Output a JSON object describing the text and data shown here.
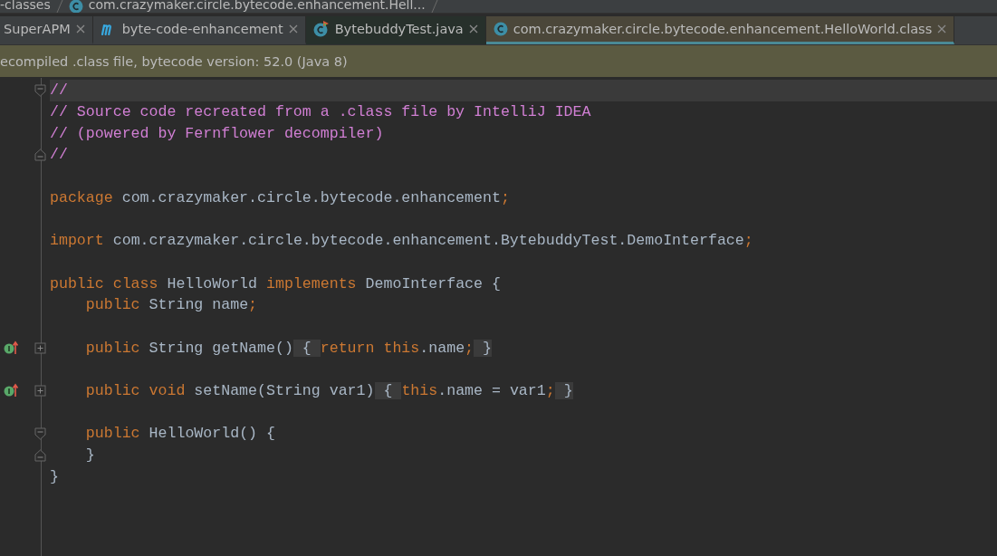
{
  "breadcrumb": [
    {
      "label": "-classes",
      "kind": "folder"
    },
    {
      "label": "com.crazymaker.circle.bytecode.enhancement.Hell...",
      "kind": "class"
    }
  ],
  "tabs": [
    {
      "label": "SuperAPM",
      "kind": "plain",
      "selected": false,
      "pinned": false
    },
    {
      "label": "byte-code-enhancement",
      "kind": "module",
      "selected": false,
      "pinned": false
    },
    {
      "label": "BytebuddyTest.java",
      "kind": "source",
      "selected": false,
      "pinned": true
    },
    {
      "label": "com.crazymaker.circle.bytecode.enhancement.HelloWorld.class",
      "kind": "class",
      "selected": true,
      "pinned": false
    }
  ],
  "banner": "ecompiled .class file, bytecode version: 52.0 (Java 8)",
  "code_lines": [
    {
      "kind": "fold-start",
      "current": true,
      "tokens": [
        {
          "kind": "comment",
          "text": "//"
        }
      ]
    },
    {
      "kind": "code",
      "tokens": [
        {
          "kind": "comment",
          "text": "// Source code recreated from a .class file by IntelliJ IDEA"
        }
      ]
    },
    {
      "kind": "code",
      "tokens": [
        {
          "kind": "comment",
          "text": "// (powered by Fernflower decompiler)"
        }
      ]
    },
    {
      "kind": "fold-end",
      "tokens": [
        {
          "kind": "comment",
          "text": "//"
        }
      ]
    },
    {
      "kind": "blank"
    },
    {
      "kind": "code",
      "tokens": [
        {
          "kind": "keyword",
          "text": "package "
        },
        {
          "kind": "plain",
          "text": "com.crazymaker.circle.bytecode.enhancement"
        },
        {
          "kind": "keyword",
          "text": ";"
        }
      ]
    },
    {
      "kind": "blank"
    },
    {
      "kind": "code",
      "tokens": [
        {
          "kind": "keyword",
          "text": "import "
        },
        {
          "kind": "plain",
          "text": "com.crazymaker.circle.bytecode.enhancement.BytebuddyTest.DemoInterface"
        },
        {
          "kind": "keyword",
          "text": ";"
        }
      ]
    },
    {
      "kind": "blank"
    },
    {
      "kind": "code",
      "tokens": [
        {
          "kind": "keyword",
          "text": "public class "
        },
        {
          "kind": "plain",
          "text": "HelloWorld "
        },
        {
          "kind": "keyword",
          "text": "implements "
        },
        {
          "kind": "plain",
          "text": "DemoInterface {"
        }
      ]
    },
    {
      "kind": "code",
      "tokens": [
        {
          "kind": "keyword",
          "text": "    public "
        },
        {
          "kind": "plain",
          "text": "String name"
        },
        {
          "kind": "keyword",
          "text": ";"
        }
      ]
    },
    {
      "kind": "blank"
    },
    {
      "kind": "collapsed-method",
      "tokens": [
        {
          "kind": "keyword",
          "text": "    public "
        },
        {
          "kind": "plain",
          "text": "String getName()"
        },
        {
          "kind": "folded",
          "text": " { "
        },
        {
          "kind": "keyword",
          "text": "return this"
        },
        {
          "kind": "plain",
          "text": ".name"
        },
        {
          "kind": "keyword",
          "text": ";"
        },
        {
          "kind": "folded",
          "text": " }"
        }
      ]
    },
    {
      "kind": "blank"
    },
    {
      "kind": "collapsed-method",
      "tokens": [
        {
          "kind": "keyword",
          "text": "    public void "
        },
        {
          "kind": "plain",
          "text": "setName(String var1)"
        },
        {
          "kind": "folded",
          "text": " { "
        },
        {
          "kind": "keyword",
          "text": "this"
        },
        {
          "kind": "plain",
          "text": ".name = var1"
        },
        {
          "kind": "keyword",
          "text": ";"
        },
        {
          "kind": "folded",
          "text": " }"
        }
      ]
    },
    {
      "kind": "blank"
    },
    {
      "kind": "fold-start",
      "tokens": [
        {
          "kind": "keyword",
          "text": "    public "
        },
        {
          "kind": "plain",
          "text": "HelloWorld() {"
        }
      ]
    },
    {
      "kind": "fold-end",
      "tokens": [
        {
          "kind": "plain",
          "text": "    }"
        }
      ]
    },
    {
      "kind": "code",
      "tokens": [
        {
          "kind": "plain",
          "text": "}"
        }
      ]
    }
  ]
}
